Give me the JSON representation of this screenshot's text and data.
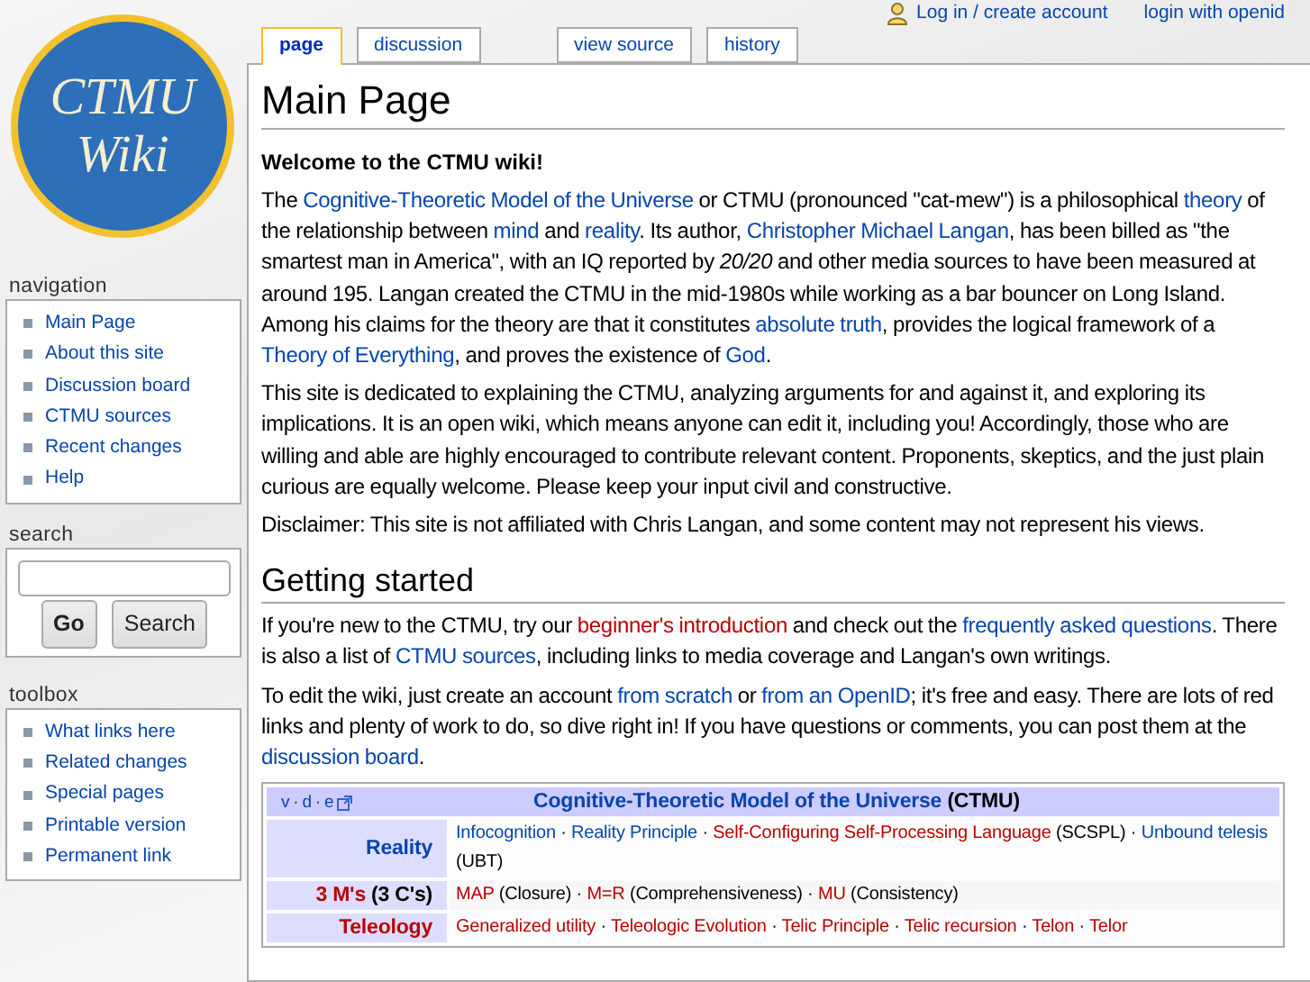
{
  "personal_links": [
    "Log in / create account",
    "login with openid"
  ],
  "logo": {
    "line_1": "CTMU",
    "line_2": "Wiki"
  },
  "tabs": [
    {
      "label": "page",
      "selected": true
    },
    {
      "label": "discussion",
      "selected": false
    }
  ],
  "action_tabs": [
    {
      "label": "view source",
      "selected": false
    },
    {
      "label": "history",
      "selected": false
    }
  ],
  "sidebar": {
    "navigation": {
      "heading": "navigation",
      "items": [
        "Main Page",
        "About this site",
        "Discussion board",
        "CTMU sources",
        "Recent changes",
        "Help"
      ]
    },
    "search": {
      "heading": "search",
      "buttons": [
        "Go",
        "Search"
      ]
    },
    "toolbox": {
      "heading": "toolbox",
      "items": [
        "What links here",
        "Related changes",
        "Special pages",
        "Printable version",
        "Permanent link"
      ]
    }
  },
  "content": {
    "title": "Main Page",
    "welcome": "Welcome to the CTMU wiki!",
    "intro_paragraphs": [
      [
        {
          "kind": "text",
          "text": "The "
        },
        {
          "kind": "link",
          "text": "Cognitive-Theoretic Model of the Universe"
        },
        {
          "kind": "text",
          "text": " or CTMU (pronounced \"cat-mew\") is a philosophical "
        },
        {
          "kind": "link",
          "text": "theory"
        },
        {
          "kind": "text",
          "text": " of the relationship between "
        },
        {
          "kind": "link",
          "text": "mind"
        },
        {
          "kind": "text",
          "text": " and "
        },
        {
          "kind": "link",
          "text": "reality"
        },
        {
          "kind": "text",
          "text": ". Its author, "
        },
        {
          "kind": "link",
          "text": "Christopher Michael Langan"
        },
        {
          "kind": "text",
          "text": ", has been billed as \"the smartest man in America\", with an IQ reported by *20/20* and other media sources to have been measured at around 195. Langan created the CTMU in the mid-1980s while working as a bar bouncer on Long Island. Among his claims for the theory are that it constitutes "
        },
        {
          "kind": "link",
          "text": "absolute truth"
        },
        {
          "kind": "text",
          "text": ", provides the logical framework of a "
        },
        {
          "kind": "link",
          "text": "Theory of Everything"
        },
        {
          "kind": "text",
          "text": ", and proves the existence of "
        },
        {
          "kind": "link",
          "text": "God"
        },
        {
          "kind": "text",
          "text": "."
        }
      ],
      [
        {
          "kind": "text",
          "text": "This site is dedicated to explaining the CTMU, analyzing arguments for and against it, and exploring its implications. It is an open wiki, which means anyone can edit it, including you! Accordingly, those who are willing and able are highly encouraged to contribute relevant content. Proponents, skeptics, and the just plain curious are equally welcome. Please keep your input civil and constructive."
        }
      ],
      [
        {
          "kind": "text",
          "text": "Disclaimer: This site is not affiliated with Chris Langan, and some content may not represent his views."
        }
      ]
    ],
    "section_heading": "Getting started",
    "section_paragraphs": [
      [
        {
          "kind": "text",
          "text": "If you're new to the CTMU, try our "
        },
        {
          "kind": "redlink",
          "text": "beginner's introduction"
        },
        {
          "kind": "text",
          "text": " and check out the "
        },
        {
          "kind": "link",
          "text": "frequently asked questions"
        },
        {
          "kind": "text",
          "text": ". There is also a list of "
        },
        {
          "kind": "link",
          "text": "CTMU sources"
        },
        {
          "kind": "text",
          "text": ", including links to media coverage and Langan's own writings."
        }
      ],
      [
        {
          "kind": "text",
          "text": "To edit the wiki, just create an account "
        },
        {
          "kind": "link",
          "text": "from scratch"
        },
        {
          "kind": "text",
          "text": " or "
        },
        {
          "kind": "link",
          "text": "from an OpenID"
        },
        {
          "kind": "text",
          "text": "; it's free and easy. There are lots of red links and plenty of work to do, so dive right in! If you have questions or comments, you can post them at the "
        },
        {
          "kind": "link",
          "text": "discussion board"
        },
        {
          "kind": "text",
          "text": "."
        }
      ]
    ]
  },
  "navbox": {
    "vde": [
      {
        "kind": "link",
        "text": "v"
      },
      {
        "kind": "separator",
        "text": "·"
      },
      {
        "kind": "link",
        "text": "d"
      },
      {
        "kind": "separator",
        "text": "·"
      },
      {
        "kind": "link",
        "text": "e"
      }
    ],
    "title": [
      {
        "kind": "link",
        "text": "Cognitive-Theoretic Model of the Universe"
      },
      {
        "kind": "text",
        "text": " (CTMU)"
      }
    ],
    "rows": [
      {
        "label": [
          {
            "kind": "link",
            "text": "Reality"
          }
        ],
        "items": [
          {
            "kind": "link",
            "text": "Infocognition"
          },
          {
            "kind": "text",
            "text": " · "
          },
          {
            "kind": "link",
            "text": "Reality Principle"
          },
          {
            "kind": "text",
            "text": " · "
          },
          {
            "kind": "redlink",
            "text": "Self-Configuring Self-Processing Language"
          },
          {
            "kind": "text",
            "text": " (SCSPL) · "
          },
          {
            "kind": "link",
            "text": "Unbound telesis"
          },
          {
            "kind": "text",
            "text": " (UBT)"
          }
        ]
      },
      {
        "label": [
          {
            "kind": "redlink",
            "text": "3 M's"
          },
          {
            "kind": "text",
            "text": " (3 C's)"
          }
        ],
        "items": [
          {
            "kind": "redlink",
            "text": "MAP"
          },
          {
            "kind": "text",
            "text": " (Closure) · "
          },
          {
            "kind": "redlink",
            "text": "M=R"
          },
          {
            "kind": "text",
            "text": " (Comprehensiveness) · "
          },
          {
            "kind": "redlink",
            "text": "MU"
          },
          {
            "kind": "text",
            "text": " (Consistency)"
          }
        ]
      },
      {
        "label": [
          {
            "kind": "redlink",
            "text": "Teleology"
          }
        ],
        "items": [
          {
            "kind": "redlink",
            "text": "Generalized utility"
          },
          {
            "kind": "text",
            "text": " · "
          },
          {
            "kind": "redlink",
            "text": "Teleologic Evolution"
          },
          {
            "kind": "text",
            "text": " · "
          },
          {
            "kind": "redlink",
            "text": "Telic Principle"
          },
          {
            "kind": "text",
            "text": " · "
          },
          {
            "kind": "redlink",
            "text": "Telic recursion"
          },
          {
            "kind": "text",
            "text": " · "
          },
          {
            "kind": "redlink",
            "text": "Telon"
          },
          {
            "kind": "text",
            "text": " · "
          },
          {
            "kind": "redlink",
            "text": "Telor"
          }
        ]
      }
    ]
  }
}
